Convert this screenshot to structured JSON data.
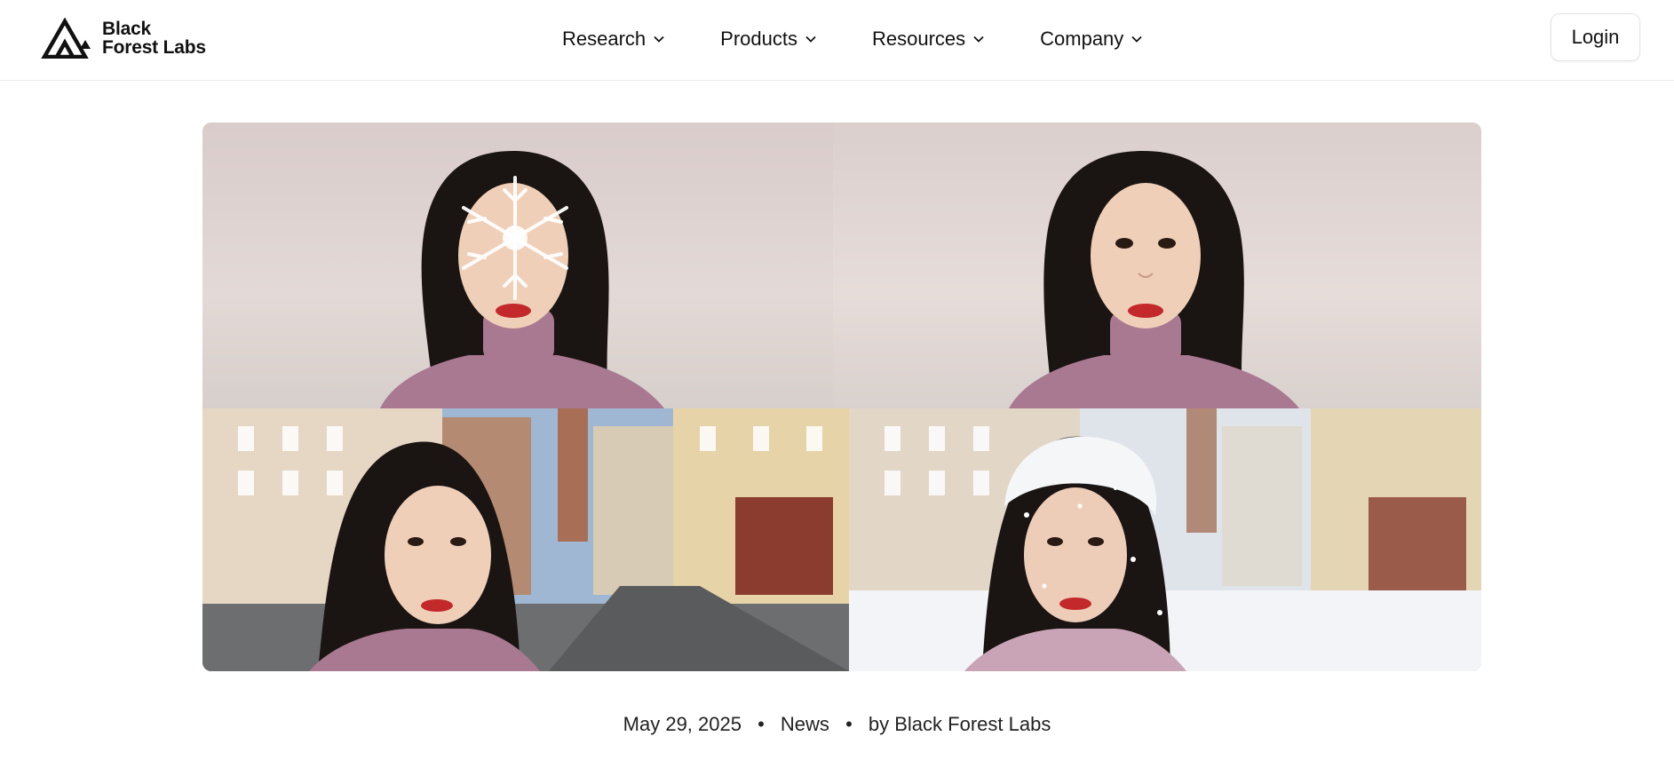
{
  "brand": {
    "name_line1": "Black",
    "name_line2": "Forest Labs",
    "logo_icon": "triangle-mountain-logo"
  },
  "nav": {
    "items": [
      {
        "label": "Research",
        "icon": "chevron-down-icon"
      },
      {
        "label": "Products",
        "icon": "chevron-down-icon"
      },
      {
        "label": "Resources",
        "icon": "chevron-down-icon"
      },
      {
        "label": "Company",
        "icon": "chevron-down-icon"
      }
    ],
    "login_label": "Login"
  },
  "hero": {
    "panels": [
      "portrait-with-snowflake-overlay",
      "portrait-plain-background",
      "selfie-city-street",
      "selfie-snowy-city-street"
    ]
  },
  "post": {
    "date": "May 29, 2025",
    "separator": "•",
    "category": "News",
    "author": "by Black Forest Labs"
  },
  "colors": {
    "sweater": "#a8788f",
    "text": "#111111",
    "border": "#e3e3e3"
  }
}
